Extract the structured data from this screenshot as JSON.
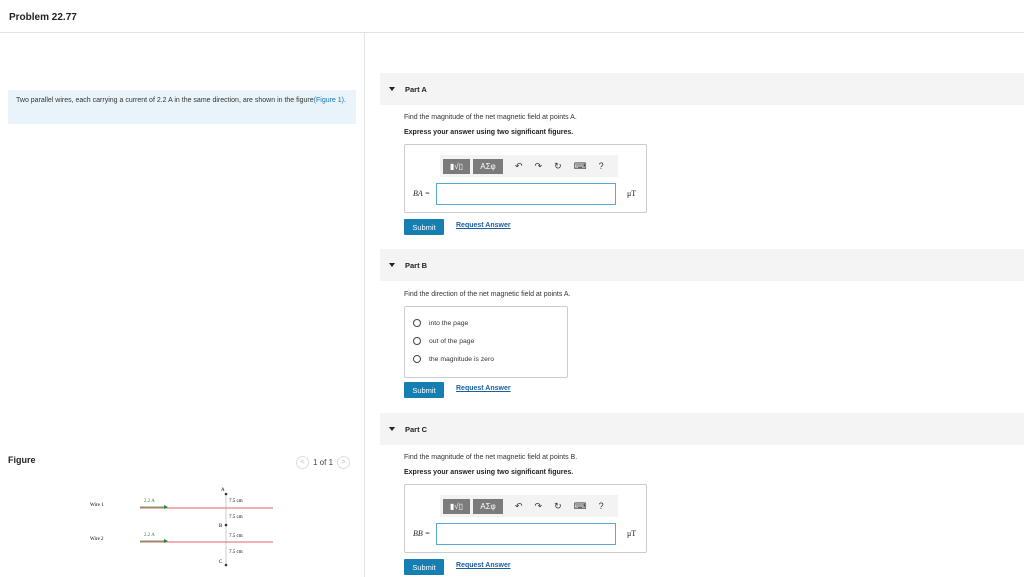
{
  "problem_title": "Problem 22.77",
  "intro": {
    "text": "Two parallel wires, each carrying a current of 2.2 A in the same direction, are shown in the figure",
    "link": "(Figure 1)",
    "end": "."
  },
  "figure": {
    "label": "Figure",
    "pager": {
      "prev": "<",
      "text": "1 of 1",
      "next": ">"
    },
    "wire1_label": "Wire 1",
    "wire2_label": "Wire 2",
    "current1": "2.2 A",
    "current2": "2.2 A",
    "point_a": "A",
    "point_b": "B",
    "point_c": "C",
    "dist1": "7.5 cm",
    "dist2": "7.5 cm",
    "dist3": "7.5 cm",
    "dist4": "7.5 cm"
  },
  "part_a": {
    "header": "Part A",
    "question": "Find the magnitude of the net magnetic field at points A.",
    "instruction": "Express your answer using two significant figures.",
    "var_label": "BA =",
    "input_value": "",
    "unit": "μT",
    "submit": "Submit",
    "request": "Request Answer"
  },
  "part_b": {
    "header": "Part B",
    "question": "Find the direction of the net magnetic field at points A.",
    "options": [
      "into the page",
      "out of the page",
      "the magnitude is zero"
    ],
    "submit": "Submit",
    "request": "Request Answer"
  },
  "part_c": {
    "header": "Part C",
    "question": "Find the magnitude of the net magnetic field at points B.",
    "instruction": "Express your answer using two significant figures.",
    "var_label": "BB =",
    "input_value": "",
    "unit": "μT",
    "submit": "Submit",
    "request": "Request Answer"
  },
  "toolbar": {
    "sqrt": "▮√▯",
    "greek": "ΑΣφ",
    "undo": "↶",
    "redo": "↷",
    "reset": "↻",
    "keyboard": "⌨",
    "help": "?"
  }
}
